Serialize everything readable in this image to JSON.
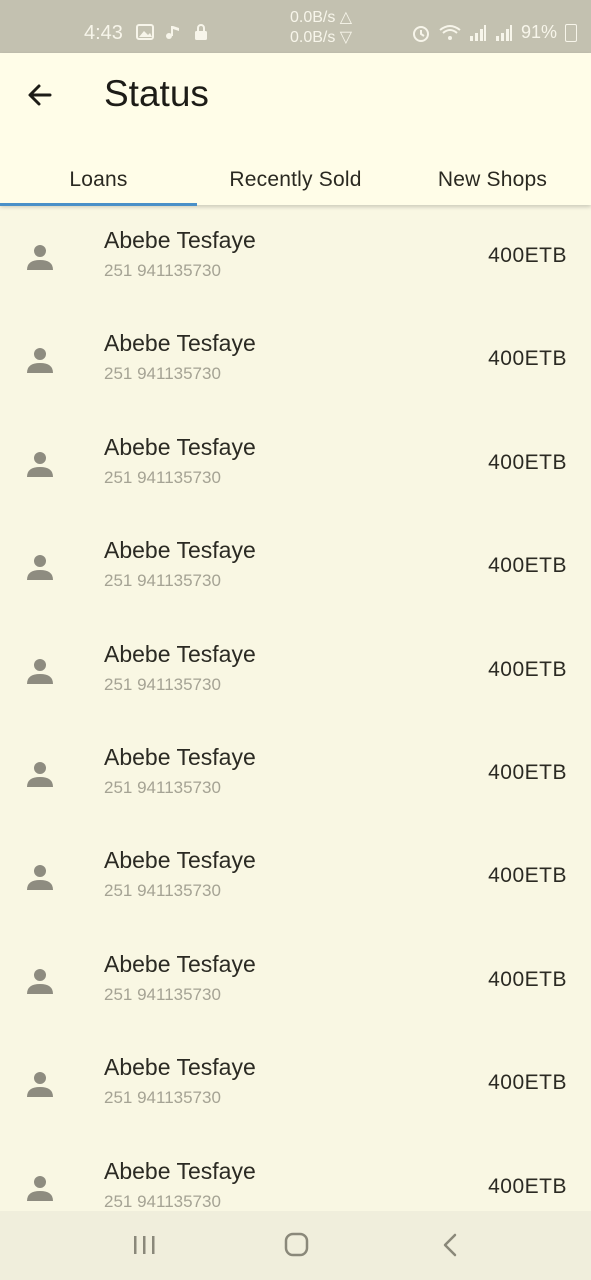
{
  "status_bar": {
    "time": "4:43",
    "speed_up": "0.0B/s",
    "speed_down": "0.0B/s",
    "battery": "91%"
  },
  "header": {
    "title": "Status"
  },
  "tabs": [
    {
      "label": "Loans",
      "active": true
    },
    {
      "label": "Recently Sold",
      "active": false
    },
    {
      "label": "New Shops",
      "active": false
    }
  ],
  "rows": [
    {
      "name": "Abebe Tesfaye",
      "phone": "251 941135730",
      "amount": "400ETB"
    },
    {
      "name": "Abebe Tesfaye",
      "phone": "251 941135730",
      "amount": "400ETB"
    },
    {
      "name": "Abebe Tesfaye",
      "phone": "251 941135730",
      "amount": "400ETB"
    },
    {
      "name": "Abebe Tesfaye",
      "phone": "251 941135730",
      "amount": "400ETB"
    },
    {
      "name": "Abebe Tesfaye",
      "phone": "251 941135730",
      "amount": "400ETB"
    },
    {
      "name": "Abebe Tesfaye",
      "phone": "251 941135730",
      "amount": "400ETB"
    },
    {
      "name": "Abebe Tesfaye",
      "phone": "251 941135730",
      "amount": "400ETB"
    },
    {
      "name": "Abebe Tesfaye",
      "phone": "251 941135730",
      "amount": "400ETB"
    },
    {
      "name": "Abebe Tesfaye",
      "phone": "251 941135730",
      "amount": "400ETB"
    },
    {
      "name": "Abebe Tesfaye",
      "phone": "251 941135730",
      "amount": "400ETB"
    }
  ],
  "icons": {
    "back": "arrow-back-icon",
    "avatar": "person-icon",
    "nav_recents": "recents-icon",
    "nav_home": "home-icon",
    "nav_back": "nav-back-icon"
  },
  "colors": {
    "tab_indicator": "#4a90c8",
    "background": "#f9f7e3",
    "appbar": "#fffde8"
  }
}
